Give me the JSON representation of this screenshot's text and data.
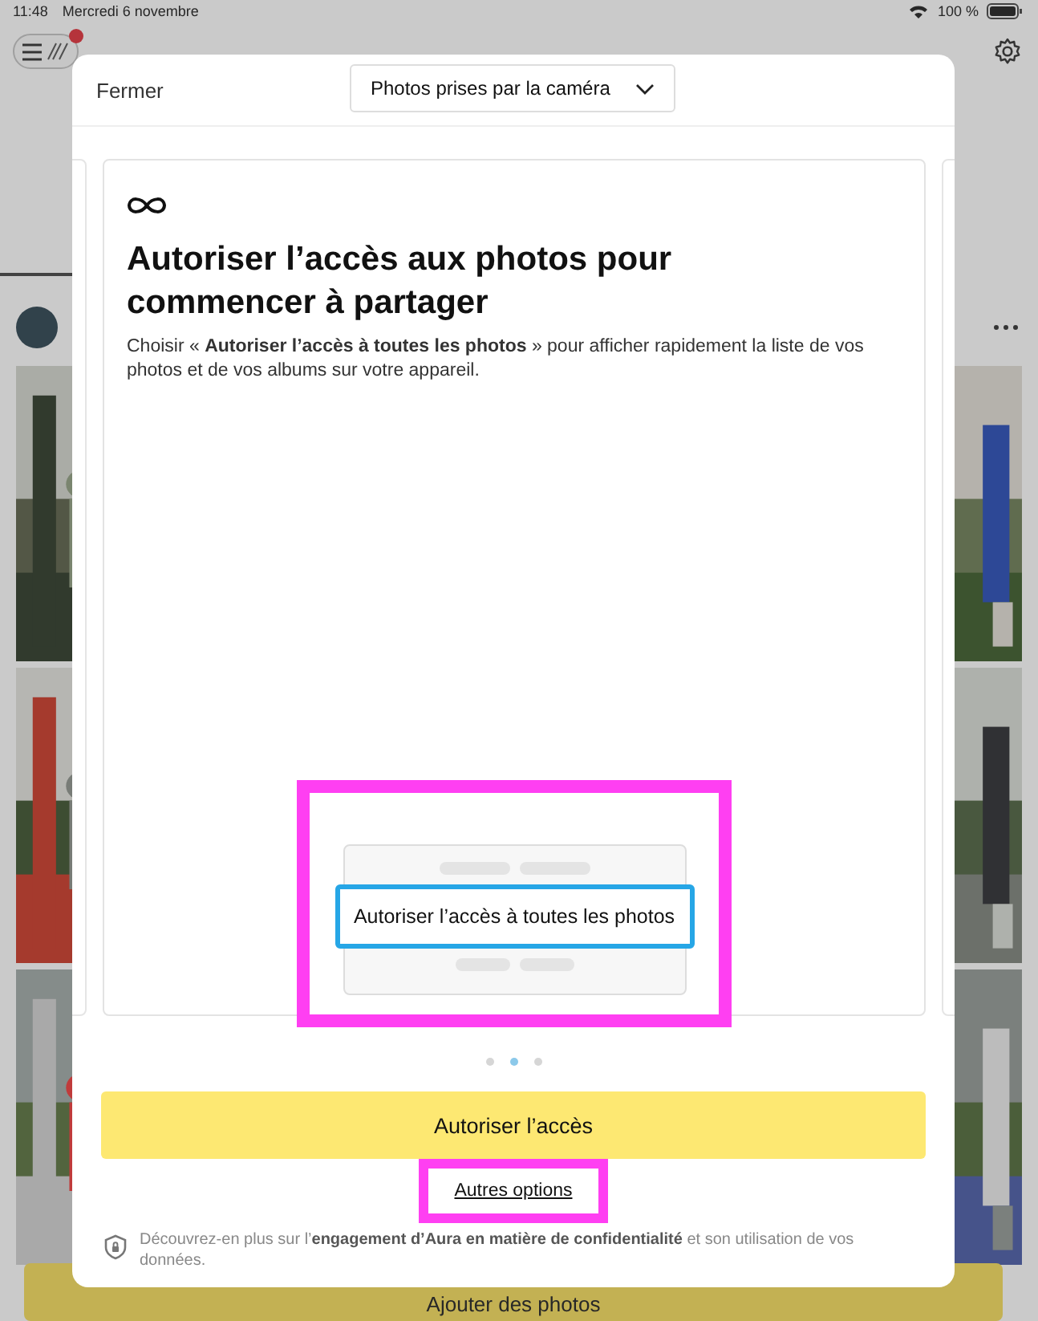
{
  "status_bar": {
    "time": "11:48",
    "date": "Mercredi 6 novembre",
    "battery": "100 %"
  },
  "background": {
    "notification_dot": true,
    "add_button": "Ajouter des photos"
  },
  "dialog": {
    "close": "Fermer",
    "album_dropdown": "Photos prises par la caméra",
    "card": {
      "title": "Autoriser l’accès aux photos pour commencer à partager",
      "description": "Choisir « **Autoriser l’accès à toutes les photos** » pour afficher rapidement la liste de vos photos et de vos albums sur votre appareil.",
      "illustration": {
        "option": "Autoriser l’accès à toutes les photos",
        "selected": true,
        "highlighted": true
      }
    },
    "pages": [
      {
        "selected": false
      },
      {
        "selected": true
      },
      {
        "selected": false
      }
    ],
    "primary_button": "Autoriser l’accès",
    "link": {
      "label": "Autres options",
      "highlighted": true
    },
    "privacy_note": "Découvrez-en plus sur l’**engagement d’Aura en matière de confidentialité** et son utilisation de vos données."
  }
}
